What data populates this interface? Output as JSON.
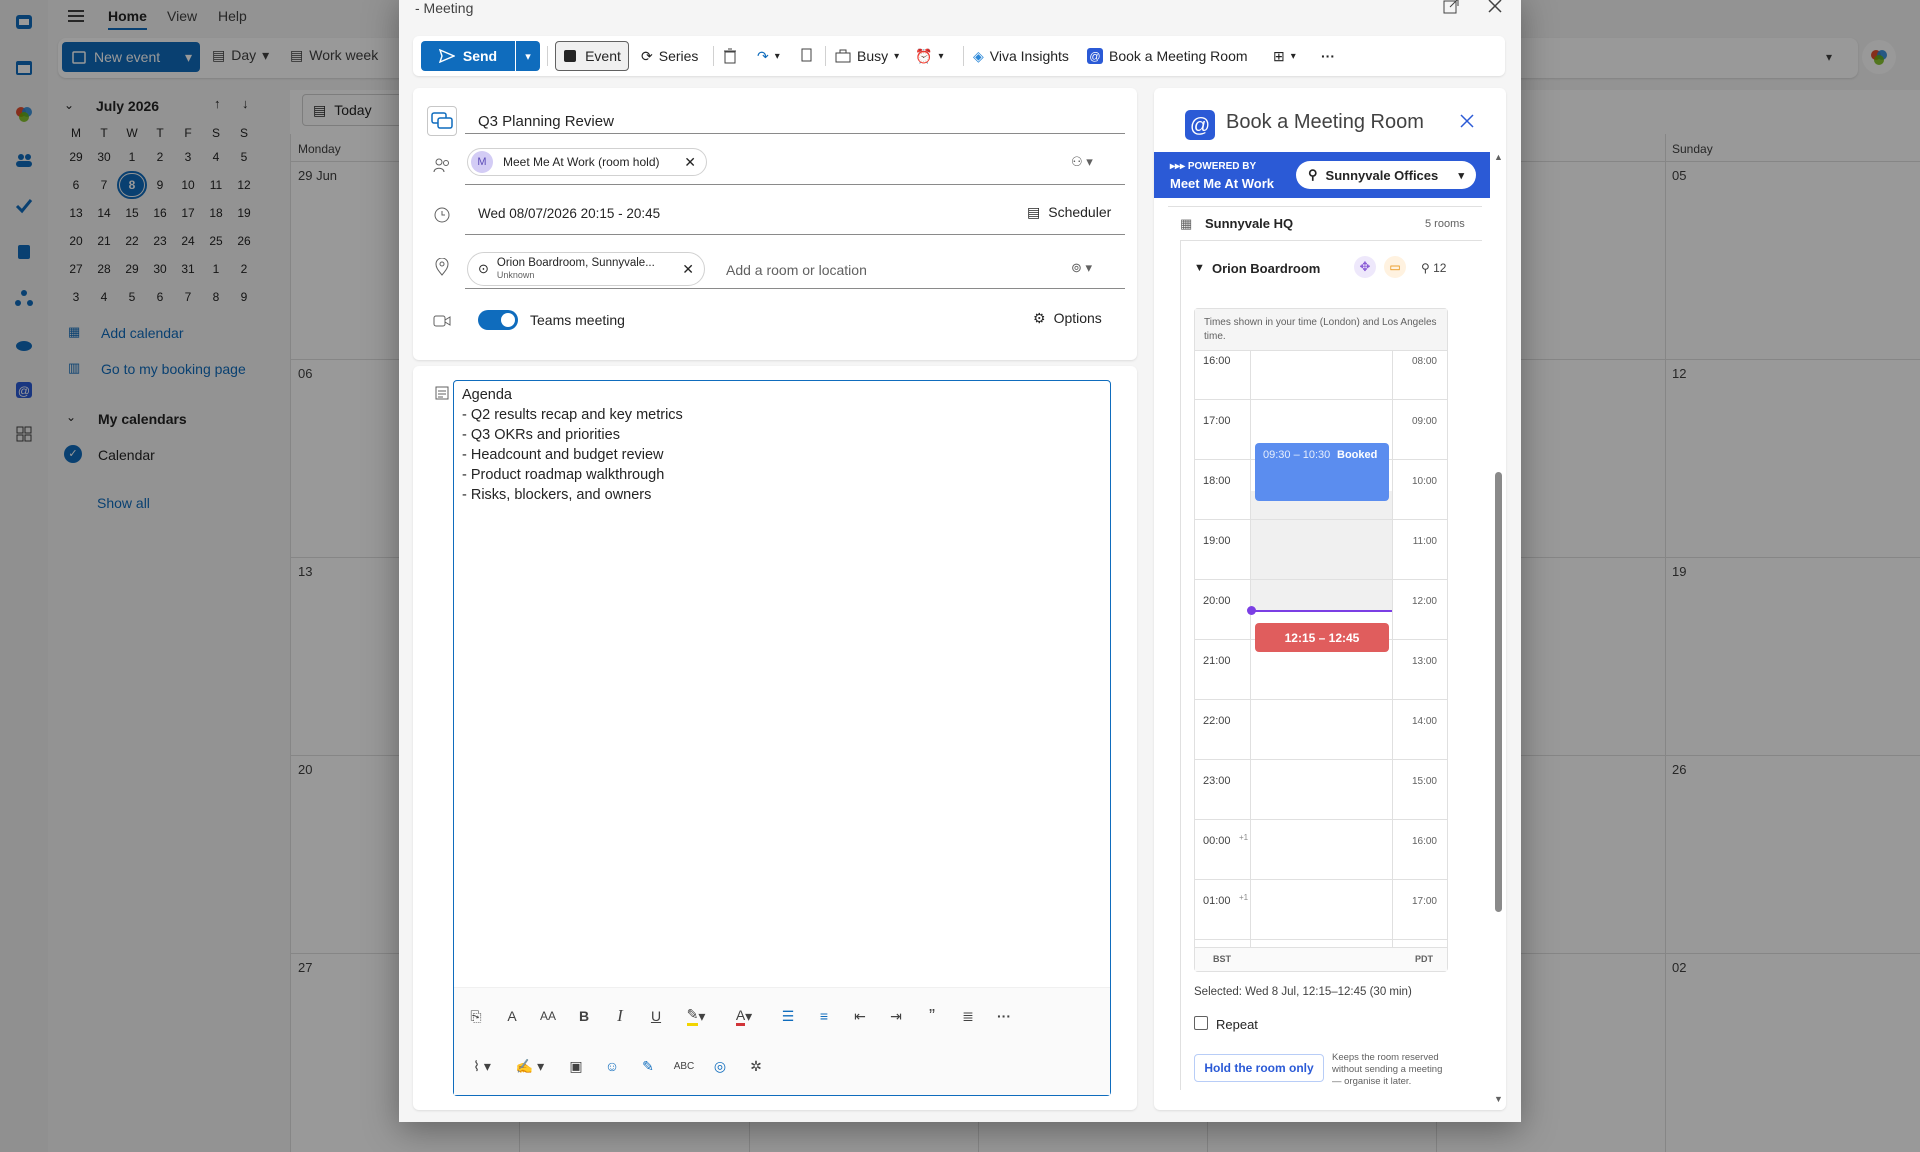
{
  "bg": {
    "tabs": [
      "Home",
      "View",
      "Help"
    ],
    "new_event": "New event",
    "view_day": "Day",
    "view_workweek": "Work week",
    "month_label": "July 2026",
    "mini_headers": [
      "M",
      "T",
      "W",
      "T",
      "F",
      "S",
      "S"
    ],
    "mini_rows": [
      [
        "29",
        "30",
        "1",
        "2",
        "3",
        "4",
        "5"
      ],
      [
        "6",
        "7",
        "8",
        "9",
        "10",
        "11",
        "12"
      ],
      [
        "13",
        "14",
        "15",
        "16",
        "17",
        "18",
        "19"
      ],
      [
        "20",
        "21",
        "22",
        "23",
        "24",
        "25",
        "26"
      ],
      [
        "27",
        "28",
        "29",
        "30",
        "31",
        "1",
        "2"
      ],
      [
        "3",
        "4",
        "5",
        "6",
        "7",
        "8",
        "9"
      ]
    ],
    "add_calendar": "Add calendar",
    "booking_page": "Go to my booking page",
    "my_calendars": "My calendars",
    "calendar": "Calendar",
    "show_all": "Show all",
    "today": "Today",
    "col_monday": "Monday",
    "col_sunday": "Sunday",
    "dates_left": [
      "29 Jun",
      "06",
      "13",
      "20",
      "27"
    ],
    "dates_right": [
      "05",
      "12",
      "19",
      "26",
      "02"
    ]
  },
  "dialog": {
    "title": "- Meeting",
    "toolbar": {
      "send": "Send",
      "event": "Event",
      "series": "Series",
      "busy": "Busy",
      "viva": "Viva Insights",
      "book": "Book a Meeting Room"
    },
    "subject": "Q3 Planning Review",
    "attendee_initial": "M",
    "attendee": "Meet Me At Work (room hold)",
    "datetime": "Wed 08/07/2026 20:15 - 20:45",
    "scheduler": "Scheduler",
    "location_name": "Orion Boardroom, Sunnyvale...",
    "location_sub": "Unknown",
    "location_placeholder": "Add a room or location",
    "teams": "Teams meeting",
    "options": "Options",
    "agenda": [
      "Agenda",
      "- Q2 results recap and key metrics",
      "- Q3 OKRs and priorities",
      "- Headcount and budget review",
      "- Product roadmap walkthrough",
      "- Risks, blockers, and owners"
    ]
  },
  "room": {
    "title": "Book a Meeting Room",
    "powered": "POWERED BY",
    "brand": "Meet Me At Work",
    "office": "Sunnyvale Offices",
    "building": "Sunnyvale HQ",
    "rooms_count": "5 rooms",
    "room_name": "Orion Boardroom",
    "capacity": "12",
    "tz_note": "Times shown in your time (London) and Los Angeles time.",
    "left_times": [
      "16:00",
      "17:00",
      "18:00",
      "19:00",
      "20:00",
      "21:00",
      "22:00",
      "23:00",
      "00:00",
      "01:00"
    ],
    "right_times": [
      "08:00",
      "09:00",
      "10:00",
      "11:00",
      "12:00",
      "13:00",
      "14:00",
      "15:00",
      "16:00",
      "17:00"
    ],
    "plus_one": "+1",
    "booked_time": "09:30 – 10:30",
    "booked_label": "Booked",
    "selected_block": "12:15 – 12:45",
    "tz_left": "BST",
    "tz_right": "PDT",
    "selected_text": "Selected: Wed 8 Jul, 12:15–12:45 (30 min)",
    "repeat": "Repeat",
    "hold": "Hold the room only",
    "hold_note": "Keeps the room reserved without sending a meeting — organise it later."
  },
  "colors": {
    "accent": "#0f6cbd",
    "banner": "#2b5ad6",
    "booked": "#5b8def",
    "selected": "#e05d5d"
  }
}
